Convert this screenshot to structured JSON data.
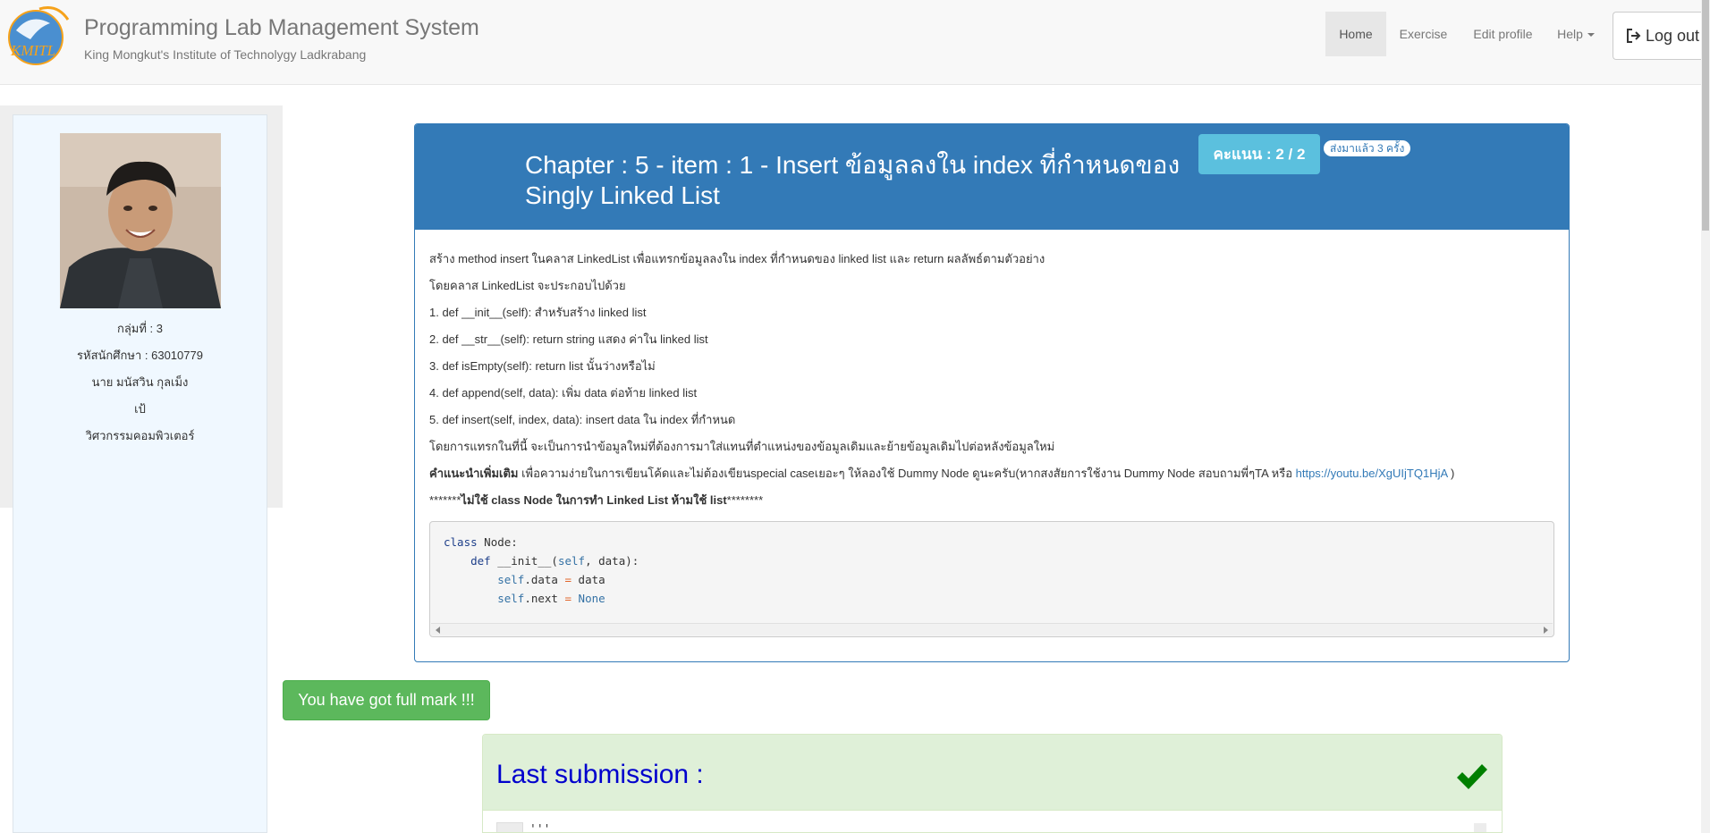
{
  "navbar": {
    "brand_title": "Programming Lab Management System",
    "brand_subtitle": "King Mongkut's Institute of Technolygy Ladkrabang",
    "logo_text": "KMITL",
    "items": [
      {
        "label": "Home",
        "active": true
      },
      {
        "label": "Exercise",
        "active": false
      },
      {
        "label": "Edit profile",
        "active": false
      },
      {
        "label": "Help",
        "active": false
      }
    ],
    "logout_label": "Log out"
  },
  "profile": {
    "group": "กลุ่มที่ : 3",
    "student_id": "รหัสนักศึกษา : 63010779",
    "name": "นาย มนัสวิน กุลเม็ง",
    "nickname": "เป้",
    "department": "วิศวกรรมคอมพิวเตอร์"
  },
  "problem": {
    "title": "Chapter : 5 - item : 1 - Insert ข้อมูลลงใน index ที่กำหนดของ Singly Linked List",
    "score": "คะแนน : 2 / 2",
    "sent_count": "ส่งมาแล้ว 3 ครั้ง",
    "lines": [
      "สร้าง method insert ในคลาส LinkedList เพื่อแทรกข้อมูลลงใน index ที่กำหนดของ linked list และ return ผลลัพธ์ตามตัวอย่าง",
      "โดยคลาส LinkedList จะประกอบไปด้วย",
      "1. def __init__(self): สำหรับสร้าง linked list",
      "2. def __str__(self): return string แสดง ค่าใน linked list",
      "3. def isEmpty(self): return list นั้นว่างหรือไม่",
      "4. def append(self, data): เพิ่ม data ต่อท้าย linked list",
      "5. def insert(self, index, data): insert data ใน index ที่กำหนด",
      "โดยการแทรกในที่นี้ จะเป็นการนำข้อมูลใหม่ที่ต้องการมาใส่แทนที่ตำแหน่งของข้อมูลเดิมและย้ายข้อมูลเดิมไปต่อหลังข้อมูลใหม่"
    ],
    "hint_label": "คำแนะนำเพิ่มเติม",
    "hint_text": " เพื่อความง่ายในการเขียนโค้ดและไม่ต้องเขียนspecial caseเยอะๆ ให้ลองใช้ Dummy Node ดูนะครับ(หากสงสัยการใช้งาน Dummy Node สอบถามพี่ๆTA หรือ ",
    "hint_link": "https://youtu.be/XgUIjTQ1HjA",
    "hint_end": " )",
    "warning_prefix": "*******",
    "warning_bold": "ไม่ใช้ class Node ในการทำ Linked List ห้ามใช้ list",
    "warning_suffix": "********",
    "code": {
      "l1_kw": "class",
      "l1_rest": " Node:",
      "l2_kw": "def",
      "l2_rest": " __init__(",
      "l2_self": "self",
      "l2_end": ", data):",
      "l3_self": "self",
      "l3_attr": ".data ",
      "l3_op": "=",
      "l3_val": " data",
      "l4_self": "self",
      "l4_attr": ".next ",
      "l4_op": "=",
      "l4_val": " None"
    }
  },
  "full_mark_label": "You have got full mark !!!",
  "last_submission": {
    "title": "Last submission :",
    "code_preview": "'''"
  },
  "colors": {
    "primary": "#337ab7",
    "info": "#5bc0de",
    "success": "#5cb85c",
    "success_bg": "#dff0d8",
    "check": "#008000"
  }
}
